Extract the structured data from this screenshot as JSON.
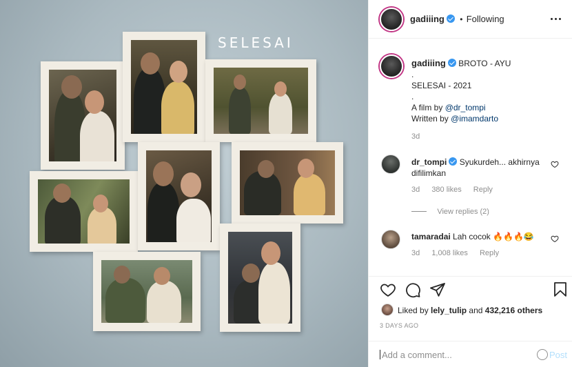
{
  "photo": {
    "wall_text": "SELESAI"
  },
  "header": {
    "username": "gadiiing",
    "separator": "•",
    "follow_label": "Following"
  },
  "caption": {
    "username": "gadiiing",
    "lines": [
      "BROTO - AYU",
      ".",
      "SELESAI - 2021",
      ".",
      "A film by",
      "Written by"
    ],
    "mention_film": "@dr_tompi",
    "mention_writer": "@imamdarto",
    "time": "3d"
  },
  "comments": [
    {
      "username": "dr_tompi",
      "text_line1": "Syukurdeh... akhirnya",
      "text_line2": "difilimkan",
      "time": "3d",
      "likes": "380 likes",
      "reply": "Reply",
      "view_replies": "View replies (2)"
    },
    {
      "username": "tamaradai",
      "text": "Lah cocok",
      "emoji": "🔥🔥🔥😂",
      "time": "3d",
      "likes": "1,008 likes",
      "reply": "Reply"
    }
  ],
  "likes": {
    "prefix": "Liked by",
    "user": "lely_tulip",
    "and_text": "and",
    "others": "432,216 others"
  },
  "post_date": "3 DAYS AGO",
  "add_comment": {
    "placeholder": "Add a comment...",
    "post_label": "Post"
  },
  "icons": {
    "like": "heart-icon",
    "comment": "comment-icon",
    "share": "share-icon",
    "save": "bookmark-icon",
    "verified": "verified-badge-icon",
    "emoji": "emoji-icon"
  },
  "colors": {
    "link": "#00376b",
    "verified": "#3897f0",
    "muted": "#8e8e8e",
    "post_button": "#b2dffc"
  }
}
